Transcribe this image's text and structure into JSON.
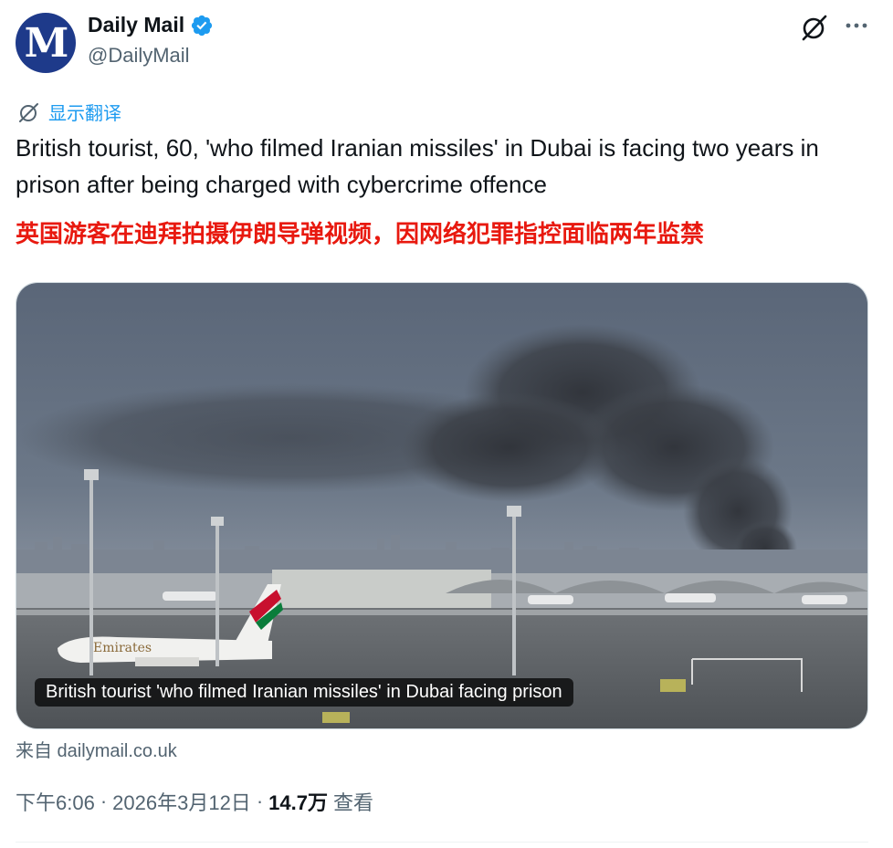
{
  "author": {
    "display_name": "Daily Mail",
    "handle": "@DailyMail",
    "avatar_letter": "M",
    "verified": true
  },
  "translate": {
    "label": "显示翻译"
  },
  "tweet": {
    "text": "British tourist, 60, 'who filmed Iranian missiles' in Dubai is facing two years in prison after being charged with cybercrime offence",
    "translation": "英国游客在迪拜拍摄伊朗导弹视频，因网络犯罪指控面临两年监禁"
  },
  "media": {
    "caption": "British tourist 'who filmed Iranian missiles' in Dubai facing prison",
    "plane_text": "Emirates"
  },
  "source": {
    "label": "来自 dailymail.co.uk"
  },
  "meta": {
    "time": "下午6:06",
    "separator": "·",
    "date": "2026年3月12日",
    "views": "14.7万",
    "views_label": "查看"
  },
  "colors": {
    "accent": "#1d9bf0",
    "translation_red": "#e8190f",
    "avatar_bg": "#1e3a8a"
  },
  "icons": {
    "verified": "verified-badge-icon",
    "grok": "grok-icon",
    "more": "more-icon",
    "translate": "translate-icon"
  }
}
